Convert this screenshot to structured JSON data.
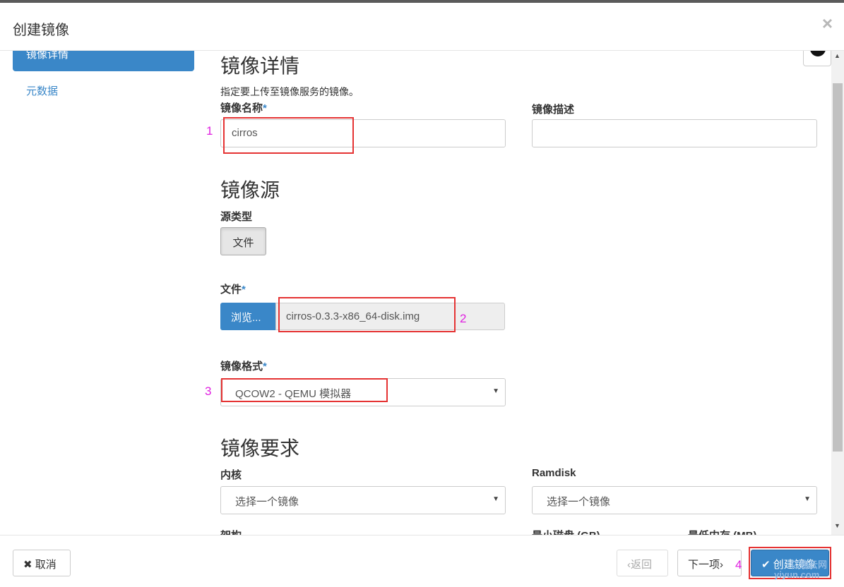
{
  "modal": {
    "title": "创建镜像",
    "close_symbol": "×"
  },
  "sidebar": {
    "items": [
      {
        "label": "镜像详情"
      },
      {
        "label": "元数据"
      }
    ]
  },
  "details": {
    "heading": "镜像详情",
    "help": "指定要上传至镜像服务的镜像。",
    "name_label": "镜像名称",
    "name_value": "cirros",
    "desc_label": "镜像描述",
    "desc_value": ""
  },
  "source": {
    "heading": "镜像源",
    "type_label": "源类型",
    "type_button": "文件",
    "file_label": "文件",
    "browse_label": "浏览...",
    "file_name": "cirros-0.3.3-x86_64-disk.img",
    "format_label": "镜像格式",
    "format_value": "QCOW2 - QEMU 模拟器"
  },
  "requirements": {
    "heading": "镜像要求",
    "kernel_label": "内核",
    "kernel_value": "选择一个镜像",
    "ramdisk_label": "Ramdisk",
    "ramdisk_value": "选择一个镜像",
    "arch_label_partial": "架构",
    "min_disk_partial": "最小磁盘 (GB)",
    "min_ram_partial": "最低内存 (MB)"
  },
  "required_marker": "*",
  "annotations": [
    "1",
    "2",
    "3",
    "4"
  ],
  "footer": {
    "cancel_label": "取消",
    "back_label": "返回",
    "next_label": "下一项",
    "create_label": "创建镜像"
  },
  "watermark": {
    "line1": "亿速云网",
    "line2": "yiyun.com"
  },
  "colors": {
    "accent": "#3a87c8",
    "highlight": "#e53333",
    "annotation": "#e020e0"
  },
  "icons": {
    "cancel": "close-icon",
    "back": "chevron-left-icon",
    "next": "chevron-right-icon",
    "create": "check-icon",
    "help": "help-icon"
  }
}
